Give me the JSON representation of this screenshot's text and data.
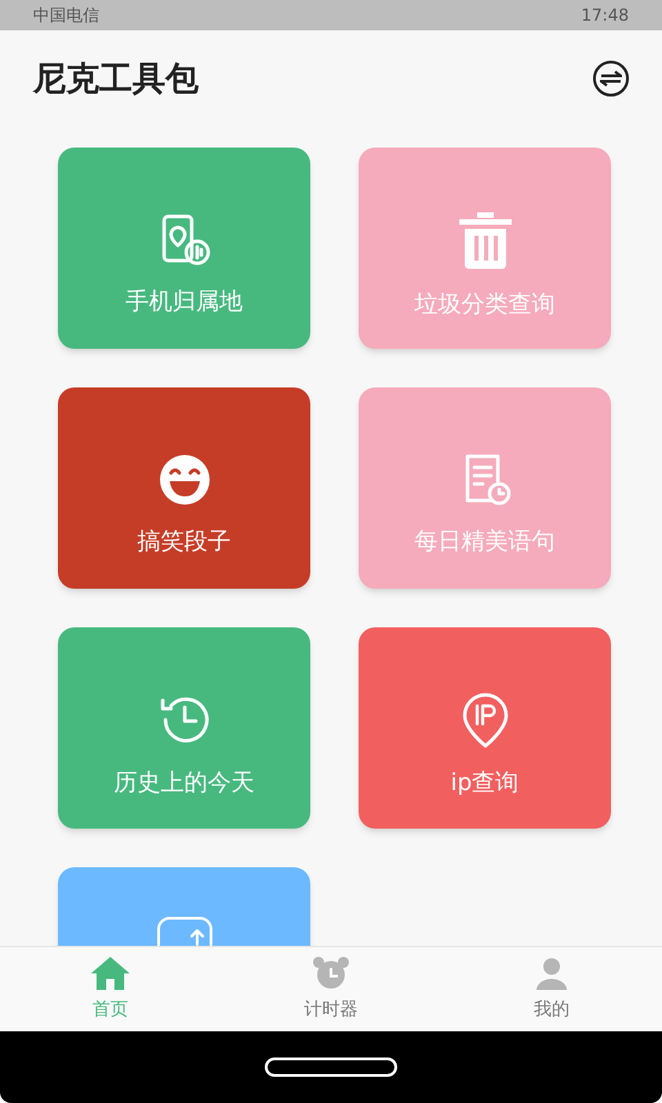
{
  "status_bar": {
    "carrier": "中国电信",
    "time": "17:48"
  },
  "header": {
    "title": "尼克工具包"
  },
  "tiles": [
    {
      "label": "手机归属地",
      "kind": "phone",
      "color": "#47b97f"
    },
    {
      "label": "垃圾分类查询",
      "kind": "trash",
      "color": "#f5abbb"
    },
    {
      "label": "搞笑段子",
      "kind": "smile",
      "color": "#c63d27"
    },
    {
      "label": "每日精美语句",
      "kind": "doc",
      "color": "#f5abbb"
    },
    {
      "label": "历史上的今天",
      "kind": "history",
      "color": "#47b97f"
    },
    {
      "label": "ip查询",
      "kind": "ip",
      "color": "#f25f5f"
    },
    {
      "kind": "convert",
      "color": "#6cb9ff"
    }
  ],
  "nav": [
    {
      "label": "首页",
      "kind": "home",
      "selected": true
    },
    {
      "label": "计时器",
      "kind": "clock",
      "selected": false
    },
    {
      "label": "我的",
      "kind": "user",
      "selected": false
    }
  ]
}
